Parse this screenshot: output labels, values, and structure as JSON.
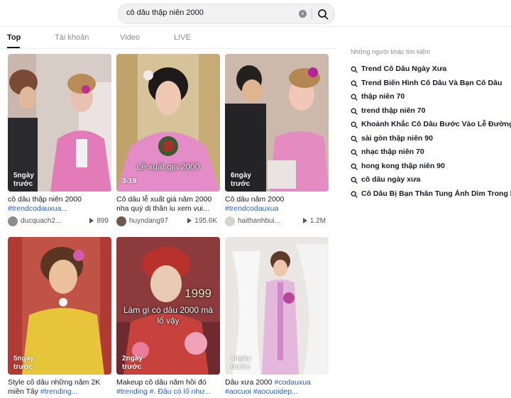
{
  "search": {
    "query": "cô dâu thập niên 2000",
    "clear_glyph": "×"
  },
  "tabs": [
    "Top",
    "Tài khoản",
    "Video",
    "LIVE"
  ],
  "videos": [
    {
      "date": "5ngày trước",
      "desc": "cô dâu thập niên 2000 ",
      "tags": "#trendcodauxua...",
      "user": "ducquach2...",
      "views": "899",
      "overlay": ""
    },
    {
      "date": "3-19",
      "desc": "Cô dâu lễ xuất giá năm 2000 nha quý dị thân iu xem vui...",
      "tags": "",
      "user": "huyndang97",
      "views": "195.6K",
      "overlay": "Lễ xuất giá 2000"
    },
    {
      "date": "6ngày trước",
      "desc": "Cô dâu năm 2000 ",
      "tags": "#trendcodauxua",
      "user": "haithanhbui...",
      "views": "1.2M",
      "overlay": ""
    },
    {
      "date": "5ngày trước",
      "desc": "Style cô dâu những năm 2K miền Tây ",
      "tags": "#trending...",
      "user": "",
      "views": "",
      "overlay": ""
    },
    {
      "date": "2ngày trước",
      "desc": "Makeup cô dâu năm hồi đó ",
      "tags": "#trending #. Đâu có lố như...",
      "user": "",
      "views": "",
      "overlay": "Làm gì có dâu 2000 mà lố vậy",
      "overlay2": "1999"
    },
    {
      "date": "4ngày trước",
      "desc": "Dâu xưa 2000 ",
      "tags": "#codauxua #aocuoi #aocuoidep...",
      "user": "",
      "views": "",
      "overlay": ""
    }
  ],
  "sidebar": {
    "title": "Những người khác tìm kiếm",
    "items": [
      "Trend Cô Dâu Ngày Xưa",
      "Trend Biến Hình Cô Dâu Và Bạn Cô Dâu",
      "thập niên 70",
      "trend thập niên 70",
      "Khoảnh Khắc Cô Dâu Bước Vào Lễ Đường",
      "sài gòn thập niên 90",
      "nhạc thập niên 70",
      "hong kong thập niên 90",
      "cô dâu ngày xưa",
      "Cô Dâu Bị Bạn Thân Tung Ảnh Dìm Trong Lễ..."
    ]
  },
  "colors": {
    "tag": "#2b5db9",
    "text": "#161823",
    "muted": "#8a8b91"
  }
}
